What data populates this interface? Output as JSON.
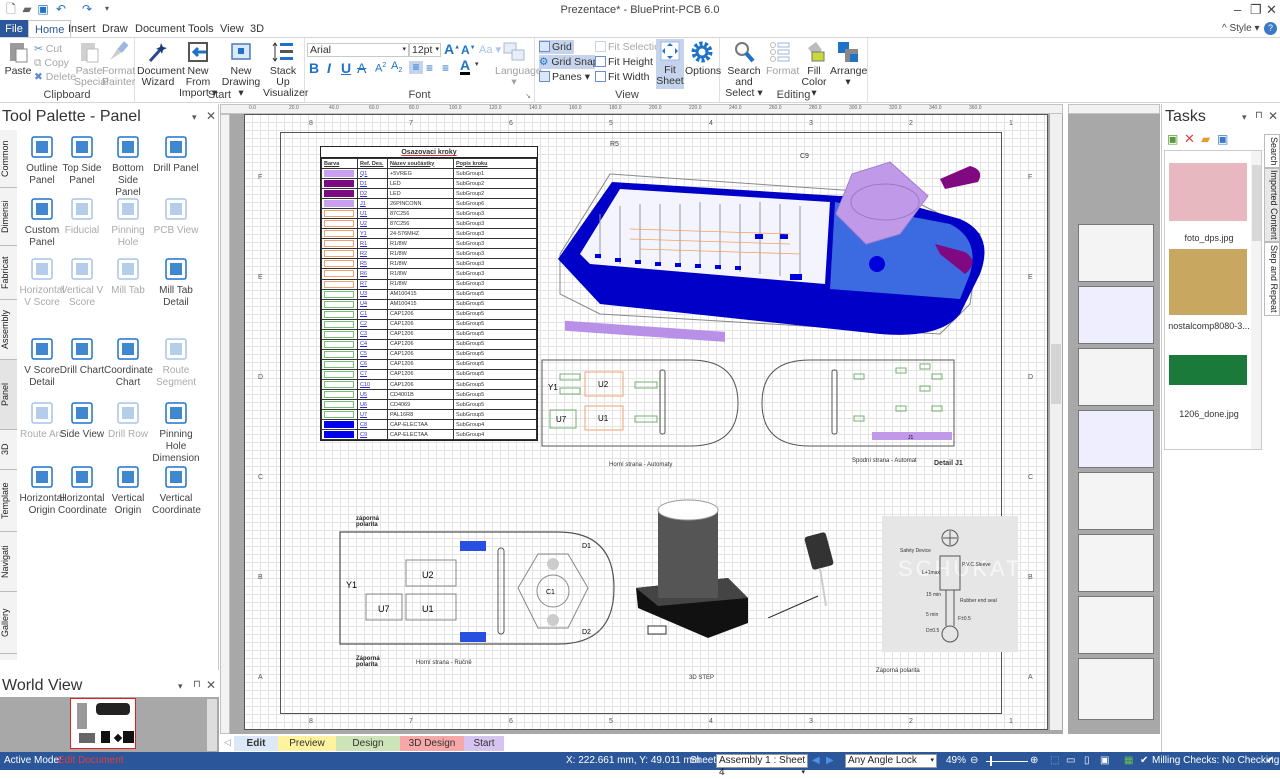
{
  "app": {
    "window_title": "Prezentace* - BluePrint-PCB 6.0",
    "style_label": "Style",
    "accent": "#2b579a"
  },
  "menu": {
    "tabs": [
      "File",
      "Home",
      "Insert",
      "Draw",
      "Document",
      "Tools",
      "View",
      "3D"
    ],
    "active": "Home"
  },
  "ribbon": {
    "clipboard": {
      "label": "Clipboard",
      "paste": "Paste",
      "cut": "Cut",
      "copy": "Copy",
      "delete": "Delete",
      "paste_special": "Paste Special",
      "format_painter": "Format Painter"
    },
    "start": {
      "label": "Start",
      "document_wizard": "Document Wizard",
      "new_from_import": "New From Import",
      "new_drawing": "New Drawing",
      "stack_up": "Stack Up Visualizer"
    },
    "font": {
      "label": "Font",
      "family": "Arial",
      "size": "12pt",
      "language": "Language",
      "change_case": "Aa"
    },
    "view": {
      "label": "View",
      "grid": "Grid",
      "grid_snap": "Grid Snap",
      "panes": "Panes",
      "fit_selection": "Fit Selection",
      "fit_height": "Fit Height",
      "fit_width": "Fit Width",
      "fit_sheet": "Fit Sheet",
      "options": "Options"
    },
    "editing": {
      "label": "Editing",
      "search_select": "Search and Select",
      "format": "Format",
      "fill_color": "Fill Color",
      "arrange": "Arrange"
    }
  },
  "tool_palette": {
    "title": "Tool Palette - Panel",
    "side_tabs": [
      "Common",
      "Dimensi",
      "Fabricat",
      "Assembly",
      "Panel",
      "3D",
      "Template",
      "Navigati",
      "Gallery"
    ],
    "active_tab": "Panel",
    "tools": [
      {
        "label": "Outline Panel",
        "icon": "outline-panel-icon",
        "enabled": true
      },
      {
        "label": "Top Side Panel",
        "icon": "top-side-panel-icon",
        "enabled": true
      },
      {
        "label": "Bottom Side Panel",
        "icon": "bottom-side-panel-icon",
        "enabled": true
      },
      {
        "label": "Drill Panel",
        "icon": "drill-panel-icon",
        "enabled": true
      },
      {
        "label": "Custom Panel",
        "icon": "custom-panel-icon",
        "enabled": true
      },
      {
        "label": "Fiducial",
        "icon": "fiducial-icon",
        "enabled": false
      },
      {
        "label": "Pinning Hole",
        "icon": "pinning-hole-icon",
        "enabled": false
      },
      {
        "label": "PCB View",
        "icon": "pcb-view-icon",
        "enabled": false
      },
      {
        "label": "Horizontal V Score",
        "icon": "horizontal-v-score-icon",
        "enabled": false
      },
      {
        "label": "Vertical V Score",
        "icon": "vertical-v-score-icon",
        "enabled": false
      },
      {
        "label": "Mill Tab",
        "icon": "mill-tab-icon",
        "enabled": false
      },
      {
        "label": "Mill Tab Detail",
        "icon": "mill-tab-detail-icon",
        "enabled": true
      },
      {
        "label": "V Score Detail",
        "icon": "v-score-detail-icon",
        "enabled": true
      },
      {
        "label": "Drill Chart",
        "icon": "drill-chart-icon",
        "enabled": true
      },
      {
        "label": "Coordinate Chart",
        "icon": "coordinate-chart-icon",
        "enabled": true
      },
      {
        "label": "Route Segment",
        "icon": "route-segment-icon",
        "enabled": false
      },
      {
        "label": "Route Arc",
        "icon": "route-arc-icon",
        "enabled": false
      },
      {
        "label": "Side View",
        "icon": "side-view-icon",
        "enabled": true
      },
      {
        "label": "Drill Row",
        "icon": "drill-row-icon",
        "enabled": false
      },
      {
        "label": "Pinning Hole Dimension",
        "icon": "pinning-hole-dimension-icon",
        "enabled": true
      },
      {
        "label": "Horizontal Origin",
        "icon": "horizontal-origin-icon",
        "enabled": true
      },
      {
        "label": "Horizontal Coordinate",
        "icon": "horizontal-coordinate-icon",
        "enabled": true
      },
      {
        "label": "Vertical Origin",
        "icon": "vertical-origin-icon",
        "enabled": true
      },
      {
        "label": "Vertical Coordinate",
        "icon": "vertical-coordinate-icon",
        "enabled": true
      }
    ]
  },
  "world_view": {
    "title": "World View"
  },
  "sheet": {
    "col_zones": [
      "8",
      "7",
      "6",
      "5",
      "4",
      "3",
      "2",
      "1"
    ],
    "row_zones": [
      "F",
      "E",
      "D",
      "C",
      "B",
      "A"
    ],
    "ruler_ticks": [
      "0.0",
      "20.0",
      "40.0",
      "60.0",
      "80.0",
      "100.0",
      "120.0",
      "140.0",
      "160.0",
      "180.0",
      "200.0",
      "220.0",
      "240.0",
      "260.0",
      "280.0",
      "300.0",
      "320.0",
      "340.0",
      "360.0"
    ],
    "bom": {
      "title": "Osazovaci kroky",
      "headers": [
        "Barva",
        "Ref. Des.",
        "Název součástky",
        "Popis kroku"
      ],
      "rows": [
        {
          "color": "#c9a0f0",
          "fill": true,
          "ref": "Q1",
          "name": "+5VREG",
          "step": "SubGroup1"
        },
        {
          "color": "#7a0a80",
          "fill": true,
          "ref": "D1",
          "name": "LED",
          "step": "SubGroup2"
        },
        {
          "color": "#7a0a80",
          "fill": true,
          "ref": "D2",
          "name": "LED",
          "step": "SubGroup2"
        },
        {
          "color": "#c9a0f0",
          "fill": true,
          "ref": "J1",
          "name": "26PINCONN",
          "step": "SubGroup6"
        },
        {
          "color": "#f0a070",
          "fill": false,
          "ref": "U1",
          "name": "87C256",
          "step": "SubGroup3"
        },
        {
          "color": "#f0a070",
          "fill": false,
          "ref": "U2",
          "name": "87C256",
          "step": "SubGroup3"
        },
        {
          "color": "#f0a070",
          "fill": false,
          "ref": "Y1",
          "name": "24-576MHZ",
          "step": "SubGroup3"
        },
        {
          "color": "#f0a070",
          "fill": false,
          "ref": "R1",
          "name": "R1/8W",
          "step": "SubGroup3"
        },
        {
          "color": "#f0a070",
          "fill": false,
          "ref": "R2",
          "name": "R1/8W",
          "step": "SubGroup3"
        },
        {
          "color": "#f0a070",
          "fill": false,
          "ref": "R5",
          "name": "R1/8W",
          "step": "SubGroup3"
        },
        {
          "color": "#f0a070",
          "fill": false,
          "ref": "R6",
          "name": "R1/8W",
          "step": "SubGroup3"
        },
        {
          "color": "#f0a070",
          "fill": false,
          "ref": "R7",
          "name": "R1/8W",
          "step": "SubGroup3"
        },
        {
          "color": "#70c070",
          "fill": false,
          "ref": "U3",
          "name": "AM100415",
          "step": "SubGroup5"
        },
        {
          "color": "#70c070",
          "fill": false,
          "ref": "U4",
          "name": "AM100415",
          "step": "SubGroup5"
        },
        {
          "color": "#70c070",
          "fill": false,
          "ref": "C1",
          "name": "CAP1206",
          "step": "SubGroup5"
        },
        {
          "color": "#70c070",
          "fill": false,
          "ref": "C2",
          "name": "CAP1206",
          "step": "SubGroup5"
        },
        {
          "color": "#70c070",
          "fill": false,
          "ref": "C3",
          "name": "CAP1206",
          "step": "SubGroup5"
        },
        {
          "color": "#70c070",
          "fill": false,
          "ref": "C4",
          "name": "CAP1206",
          "step": "SubGroup5"
        },
        {
          "color": "#70c070",
          "fill": false,
          "ref": "C5",
          "name": "CAP1206",
          "step": "SubGroup5"
        },
        {
          "color": "#70c070",
          "fill": false,
          "ref": "C6",
          "name": "CAP1206",
          "step": "SubGroup5"
        },
        {
          "color": "#70c070",
          "fill": false,
          "ref": "C7",
          "name": "CAP1206",
          "step": "SubGroup5"
        },
        {
          "color": "#70c070",
          "fill": false,
          "ref": "C10",
          "name": "CAP1206",
          "step": "SubGroup5"
        },
        {
          "color": "#70c070",
          "fill": false,
          "ref": "U5",
          "name": "CD4001B",
          "step": "SubGroup5"
        },
        {
          "color": "#70c070",
          "fill": false,
          "ref": "U6",
          "name": "CD4069",
          "step": "SubGroup5"
        },
        {
          "color": "#70c070",
          "fill": false,
          "ref": "U7",
          "name": "PAL16R8",
          "step": "SubGroup5"
        },
        {
          "color": "#0000ee",
          "fill": true,
          "ref": "C8",
          "name": "CAP-ELECTAA",
          "step": "SubGroup4"
        },
        {
          "color": "#0000ee",
          "fill": true,
          "ref": "C9",
          "name": "CAP-ELECTAA",
          "step": "SubGroup4"
        }
      ]
    },
    "captions": {
      "top_auto": "Horní strana - Automaty",
      "bottom_auto": "Spodní strana - Automat",
      "detail_j1": "Detail J1",
      "top_manual": "Horní strana - Ručně",
      "neg_pol_1": "záporná polarita",
      "neg_pol_2": "Záporná polarita",
      "step_3d": "3D STEP",
      "neg_pol_img": "Záporná polarita",
      "label_y1": "Y1",
      "label_u2": "U2",
      "label_u7": "U7",
      "label_u1": "U1",
      "label_d1": "D1",
      "label_d2": "D2",
      "label_c1": "C1",
      "label_r5": "R5",
      "label_c9": "C9",
      "label_j1": "J1",
      "datasheet": {
        "safety": "Safety Device",
        "sleeve": "P.V.C.Sleeve",
        "lmax": "L+1max",
        "min15": "15 min",
        "rubber": "Rubber end seal",
        "min5": "5 min",
        "fd": "F±0.5",
        "dd": "D±0.5",
        "watermark": "SCHUKAT"
      }
    }
  },
  "bottom_tabs": [
    {
      "label": "Edit",
      "color": "#dce8f8",
      "active": true
    },
    {
      "label": "Preview",
      "color": "#fff3a0",
      "active": false
    },
    {
      "label": "Design",
      "color": "#cde3b8",
      "active": false
    },
    {
      "label": "3D Design",
      "color": "#f6a8a8",
      "active": false
    },
    {
      "label": "Start",
      "color": "#d6c4f0",
      "active": false
    }
  ],
  "tasks": {
    "title": "Tasks",
    "side_tabs": [
      "Search",
      "Imported Content",
      "Step and Repeat"
    ],
    "items": [
      {
        "name": "foto_dps.jpg"
      },
      {
        "name": "nostalcomp8080-3..."
      },
      {
        "name": "1206_done.jpg"
      }
    ]
  },
  "status": {
    "active_mode_label": "Active Mode:",
    "active_mode_value": "Edit Document",
    "coords": "X: 222.661 mm, Y: 49.011 mm",
    "sheet_label": "Sheet:",
    "sheet_value": "Assembly 1 : Sheet 4",
    "angle_lock": "Any Angle Lock",
    "zoom": "49%",
    "milling": "Milling Checks: No Checking"
  }
}
